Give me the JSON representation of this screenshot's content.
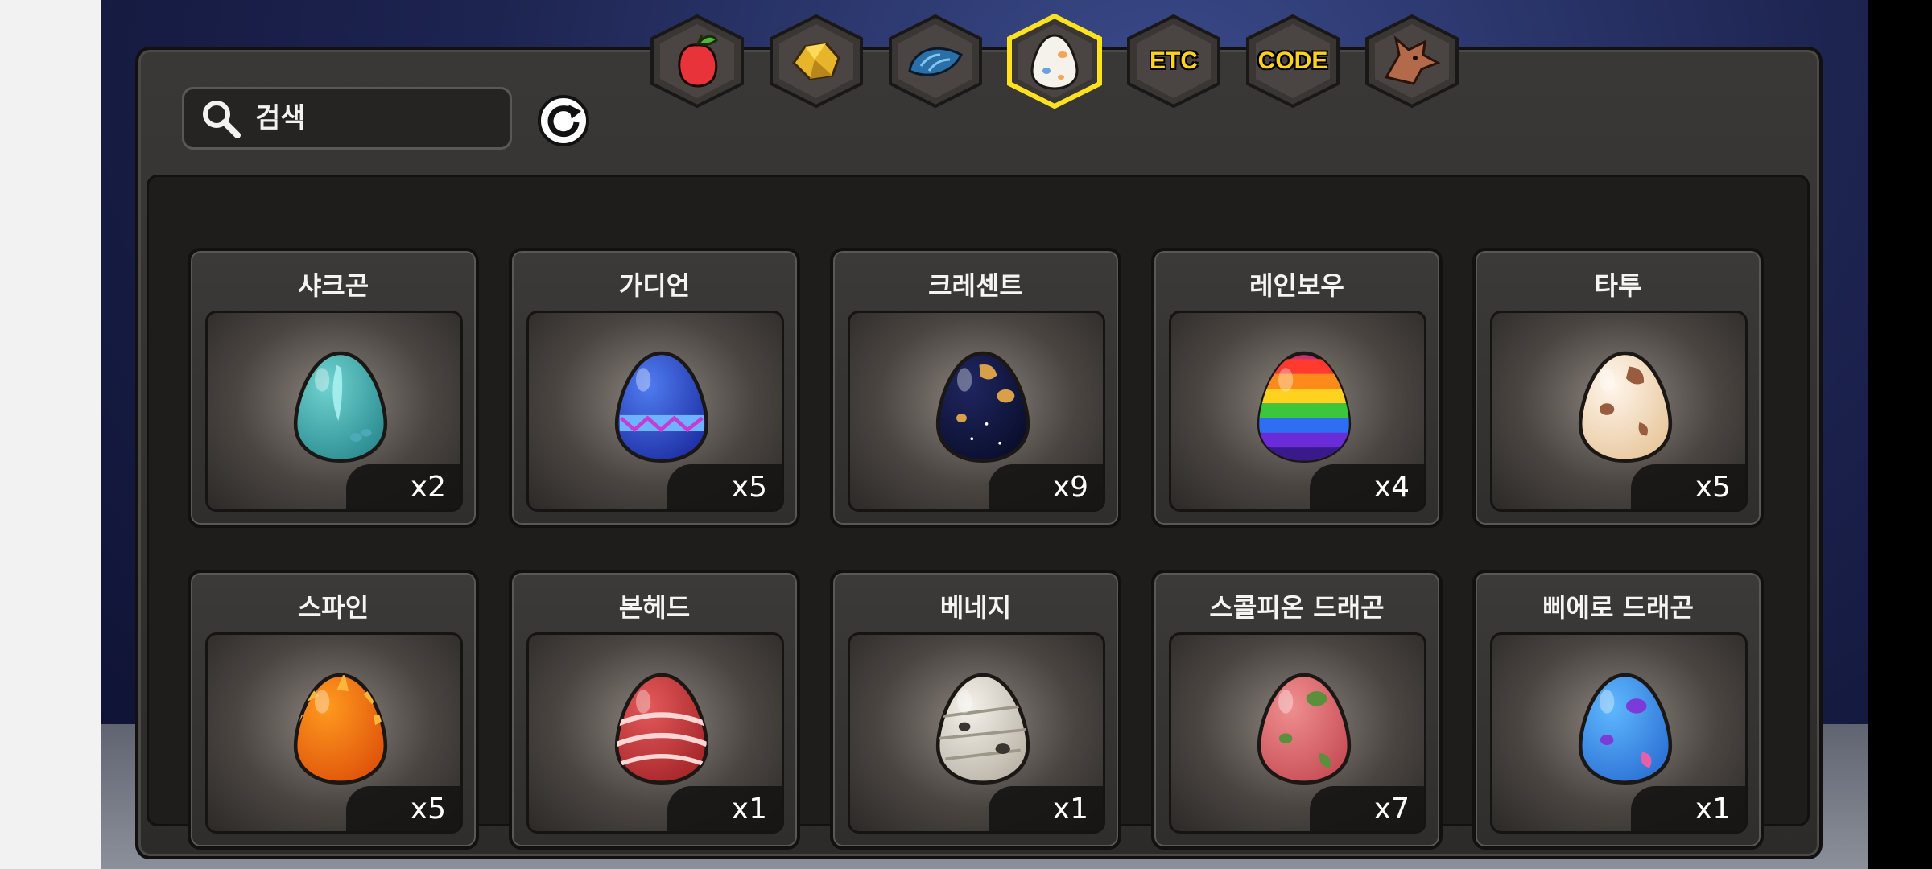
{
  "search": {
    "placeholder": "검색",
    "value": ""
  },
  "tabs": [
    {
      "name": "tab-fruit",
      "icon": "fruit-icon",
      "active": false
    },
    {
      "name": "tab-ore",
      "icon": "gold-ore-icon",
      "active": false
    },
    {
      "name": "tab-scale",
      "icon": "blue-scale-icon",
      "active": false
    },
    {
      "name": "tab-egg",
      "icon": "egg-icon",
      "active": true
    },
    {
      "name": "tab-etc",
      "label": "ETC",
      "active": false
    },
    {
      "name": "tab-code",
      "label": "CODE",
      "active": false
    },
    {
      "name": "tab-dragon",
      "icon": "dragon-head-icon",
      "active": false
    }
  ],
  "eggs": [
    {
      "name": "샤크곤",
      "qty": "x2",
      "colors": [
        "#6fd3d0",
        "#2f8f94"
      ],
      "pattern": "fin"
    },
    {
      "name": "가디언",
      "qty": "x5",
      "colors": [
        "#4f7cf0",
        "#2133a8"
      ],
      "pattern": "band"
    },
    {
      "name": "크레센트",
      "qty": "x9",
      "colors": [
        "#1f2660",
        "#0b0f2e"
      ],
      "pattern": "spots-gold"
    },
    {
      "name": "레인보우",
      "qty": "x4",
      "colors": [
        "#ff3b30",
        "#6a2bd8"
      ],
      "pattern": "rainbow"
    },
    {
      "name": "타투",
      "qty": "x5",
      "colors": [
        "#fff6ec",
        "#e9c9a0"
      ],
      "pattern": "spots-brown"
    },
    {
      "name": "스파인",
      "qty": "x5",
      "colors": [
        "#ff9a1e",
        "#e0560c"
      ],
      "pattern": "spikes"
    },
    {
      "name": "본헤드",
      "qty": "x1",
      "colors": [
        "#e4595a",
        "#a8282c"
      ],
      "pattern": "ribs"
    },
    {
      "name": "베네지",
      "qty": "x1",
      "colors": [
        "#f4f1ea",
        "#bdb7ab"
      ],
      "pattern": "bandage"
    },
    {
      "name": "스콜피온 드래곤",
      "qty": "x7",
      "colors": [
        "#ef8f8f",
        "#c9505a"
      ],
      "pattern": "spots-green"
    },
    {
      "name": "삐에로 드래곤",
      "qty": "x1",
      "colors": [
        "#5fb8ff",
        "#2f74d6"
      ],
      "pattern": "spots-pink"
    }
  ],
  "close": {
    "icon": "close-icon"
  },
  "refresh": {
    "icon": "refresh-icon"
  }
}
